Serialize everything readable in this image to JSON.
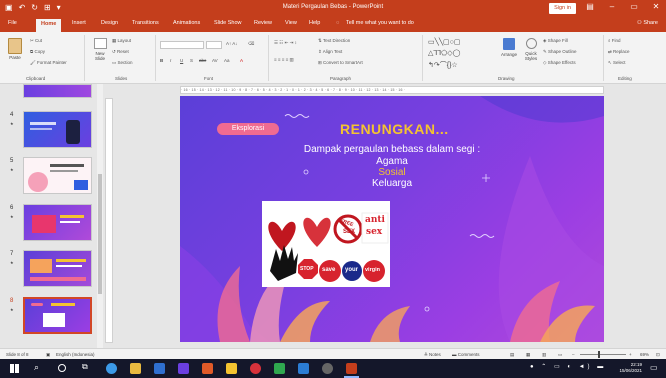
{
  "window": {
    "title": "Materi Pergaulan Bebas  -  PowerPoint",
    "signin": "Sign in",
    "minimize": "–",
    "restore": "▭",
    "close": "✕"
  },
  "tabs": {
    "items": [
      "File",
      "Home",
      "Insert",
      "Design",
      "Transitions",
      "Animations",
      "Slide Show",
      "Review",
      "View",
      "Help"
    ],
    "tell_me": "Tell me what you want to do",
    "share": "Share"
  },
  "ribbon": {
    "clipboard": {
      "paste": "Paste",
      "cut": "Cut",
      "copy": "Copy",
      "format_painter": "Format Painter",
      "label": "Clipboard"
    },
    "slides": {
      "new_slide": "New Slide",
      "layout": "Layout",
      "reset": "Reset",
      "section": "Section",
      "label": "Slides"
    },
    "font": {
      "label": "Font",
      "bold": "B",
      "italic": "I",
      "underline": "U",
      "shadow": "S",
      "strike": "abc",
      "aa": "Aa"
    },
    "paragraph": {
      "text_direction": "Text Direction",
      "align_text": "Align Text",
      "convert_smartart": "Convert to SmartArt",
      "label": "Paragraph"
    },
    "drawing": {
      "arrange": "Arrange",
      "quick_styles": "Quick Styles",
      "shape_fill": "Shape Fill",
      "shape_outline": "Shape Outline",
      "shape_effects": "Shape Effects",
      "label": "Drawing"
    },
    "editing": {
      "find": "Find",
      "replace": "Replace",
      "select": "Select",
      "label": "Editing"
    }
  },
  "thumbnails": [
    {
      "num": "4"
    },
    {
      "num": "5"
    },
    {
      "num": "6"
    },
    {
      "num": "7"
    },
    {
      "num": "8"
    }
  ],
  "ruler": "· 16 · 15 · 14 · 13 · 12 · 11 · 10 · 9 · 8 · 7 · 6 · 5 · 4 · 3 · 2 · 1 · 0 · 1 · 2 · 3 · 4 · 5 · 6 · 7 · 8 · 9 · 10 · 11 · 12 · 13 · 14 · 15 · 16 ·",
  "slide": {
    "tag": "Eksplorasi",
    "title": "RENUNGKAN...",
    "subtitle": "Dampak pergaulan bebass dalam segi :",
    "items": [
      "Agama",
      "Sosial",
      "Keluarga"
    ],
    "image_text": {
      "free": "FREE",
      "sex": "SEX",
      "anti": "anti",
      "sex2": "sex",
      "stop": "STOP",
      "save": "save",
      "your": "your",
      "virgin": "virgin"
    }
  },
  "status": {
    "slide_of": "Slide 8 of 8",
    "language": "English (Indonesia)",
    "notes": "Notes",
    "comments": "Comments",
    "zoom": "69%"
  },
  "taskbar": {
    "time": "22:19",
    "date": "15/06/2021"
  },
  "colors": {
    "brand": "#c43e1c",
    "slide_title": "#f4c330",
    "tag_pink": "#f06b91",
    "taskbar": "#14172a"
  }
}
